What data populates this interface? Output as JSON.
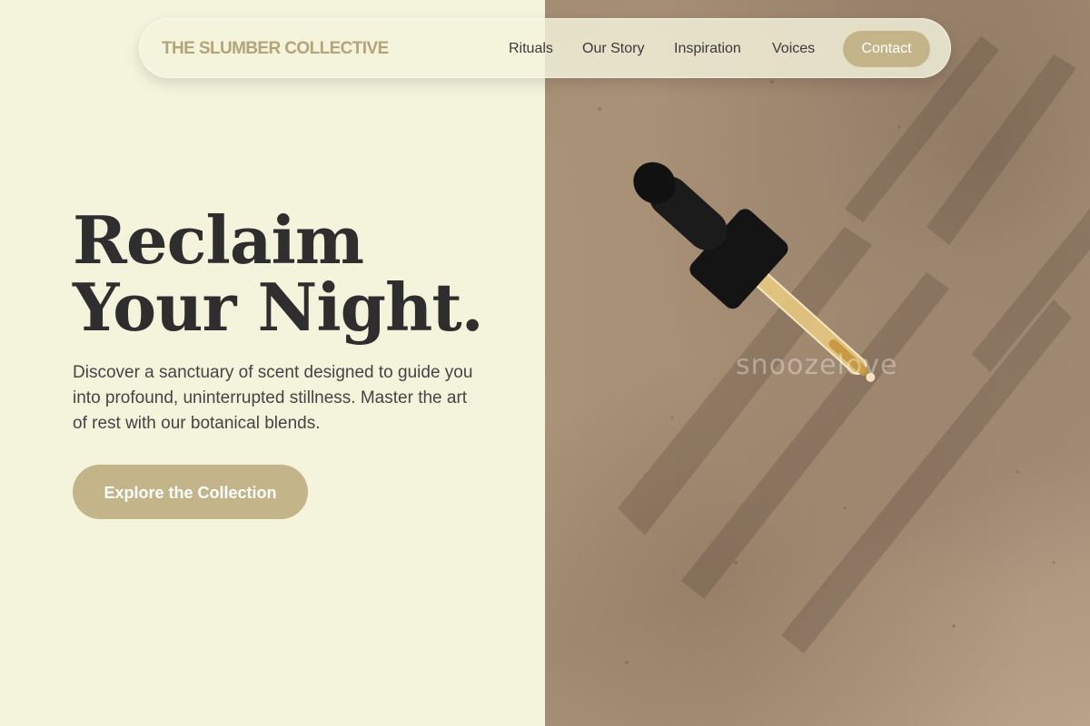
{
  "nav": {
    "brand": "THE SLUMBER COLLECTIVE",
    "links": [
      {
        "label": "Rituals"
      },
      {
        "label": "Our Story"
      },
      {
        "label": "Inspiration"
      },
      {
        "label": "Voices"
      }
    ],
    "cta_label": "Contact"
  },
  "hero": {
    "title": "Reclaim Your Night.",
    "subtitle": "Discover a sanctuary of scent designed to guide you into profound, uninterrupted stillness. Master the art of rest with our botanical blends.",
    "cta_label": "Explore the Collection"
  },
  "image": {
    "watermark": "snoozelove",
    "subject": "dropper-bottle-photo"
  },
  "colors": {
    "background": "#f4f3dc",
    "accent": "#c4b48a",
    "brand_text": "#b4a47a",
    "heading": "#2e2e2e"
  }
}
